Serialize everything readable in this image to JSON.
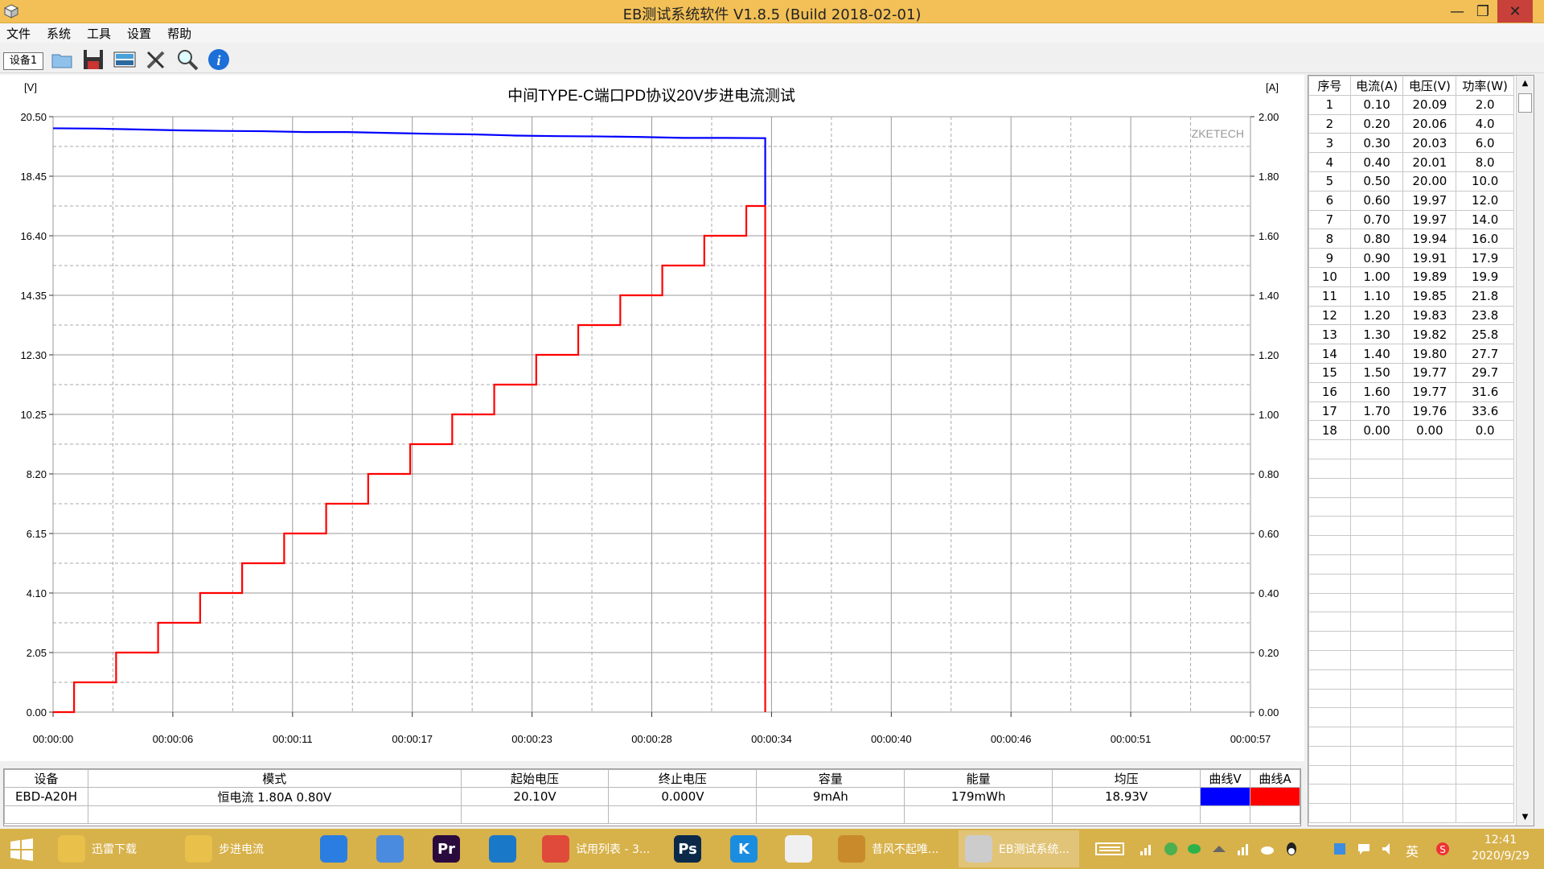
{
  "window": {
    "title": "EB测试系统软件 V1.8.5 (Build 2018-02-01)",
    "min": "—",
    "max": "❐",
    "close": "✕"
  },
  "menu": [
    "文件",
    "系统",
    "工具",
    "设置",
    "帮助"
  ],
  "toolbar": {
    "device_tab": "设备1"
  },
  "chart_data": {
    "type": "line",
    "title": "中间TYPE-C端口PD协议20V步进电流测试",
    "ylabel_left": "[V]",
    "ylabel_right": "[A]",
    "watermark": "ZKETECH",
    "x_ticks": [
      "00:00:00",
      "00:00:06",
      "00:00:11",
      "00:00:17",
      "00:00:23",
      "00:00:28",
      "00:00:34",
      "00:00:40",
      "00:00:46",
      "00:00:51",
      "00:00:57"
    ],
    "y_left_ticks": [
      "20.50",
      "18.45",
      "16.40",
      "14.35",
      "12.30",
      "10.25",
      "8.20",
      "6.15",
      "4.10",
      "2.05",
      "0.00"
    ],
    "y_right_ticks": [
      "2.00",
      "1.80",
      "1.60",
      "1.40",
      "1.20",
      "1.00",
      "0.80",
      "0.60",
      "0.40",
      "0.20",
      "0.00"
    ],
    "ylim_left": [
      0,
      20.5
    ],
    "ylim_right": [
      0,
      2.0
    ],
    "xlim_seconds": [
      0,
      57
    ],
    "grid": true,
    "series": [
      {
        "name": "曲线V",
        "color": "#0000ff",
        "axis": "left",
        "t": [
          0,
          2,
          4,
          6,
          8,
          10,
          12,
          14,
          16,
          18,
          20,
          22,
          24,
          26,
          28,
          30,
          32,
          33.9,
          33.9
        ],
        "values": [
          20.1,
          20.09,
          20.06,
          20.03,
          20.01,
          20.0,
          19.97,
          19.97,
          19.94,
          19.91,
          19.89,
          19.85,
          19.83,
          19.82,
          19.8,
          19.77,
          19.77,
          19.76,
          17.45
        ]
      },
      {
        "name": "曲线A",
        "color": "#ff0000",
        "axis": "right",
        "t": [
          0,
          1,
          3,
          5,
          7,
          9,
          11,
          13,
          15,
          17,
          19,
          21,
          23,
          25,
          27,
          29,
          31,
          33,
          33.9,
          33.9
        ],
        "values": [
          0.0,
          0.1,
          0.2,
          0.3,
          0.4,
          0.5,
          0.6,
          0.7,
          0.8,
          0.9,
          1.0,
          1.1,
          1.2,
          1.3,
          1.4,
          1.5,
          1.6,
          1.7,
          1.7,
          0.0
        ]
      }
    ]
  },
  "summary": {
    "headers": [
      "设备",
      "模式",
      "起始电压",
      "终止电压",
      "容量",
      "能量",
      "均压",
      "曲线V",
      "曲线A"
    ],
    "row": {
      "device": "EBD-A20H",
      "mode": "恒电流 1.80A 0.80V",
      "start_v": "20.10V",
      "end_v": "0.000V",
      "capacity": "9mAh",
      "energy": "179mWh",
      "avg_v": "18.93V"
    },
    "curve_v_color": "#0000ff",
    "curve_a_color": "#ff0000"
  },
  "data_table": {
    "headers": [
      "序号",
      "电流(A)",
      "电压(V)",
      "功率(W)"
    ],
    "rows": [
      [
        "1",
        "0.10",
        "20.09",
        "2.0"
      ],
      [
        "2",
        "0.20",
        "20.06",
        "4.0"
      ],
      [
        "3",
        "0.30",
        "20.03",
        "6.0"
      ],
      [
        "4",
        "0.40",
        "20.01",
        "8.0"
      ],
      [
        "5",
        "0.50",
        "20.00",
        "10.0"
      ],
      [
        "6",
        "0.60",
        "19.97",
        "12.0"
      ],
      [
        "7",
        "0.70",
        "19.97",
        "14.0"
      ],
      [
        "8",
        "0.80",
        "19.94",
        "16.0"
      ],
      [
        "9",
        "0.90",
        "19.91",
        "17.9"
      ],
      [
        "10",
        "1.00",
        "19.89",
        "19.9"
      ],
      [
        "11",
        "1.10",
        "19.85",
        "21.8"
      ],
      [
        "12",
        "1.20",
        "19.83",
        "23.8"
      ],
      [
        "13",
        "1.30",
        "19.82",
        "25.8"
      ],
      [
        "14",
        "1.40",
        "19.80",
        "27.7"
      ],
      [
        "15",
        "1.50",
        "19.77",
        "29.7"
      ],
      [
        "16",
        "1.60",
        "19.77",
        "31.6"
      ],
      [
        "17",
        "1.70",
        "19.76",
        "33.6"
      ],
      [
        "18",
        "0.00",
        "0.00",
        "0.0"
      ]
    ],
    "empty_rows": 20
  },
  "taskbar": {
    "apps": [
      {
        "label": "迅雷下载",
        "icon": "folder-icon",
        "color": "#e8c04a"
      },
      {
        "label": "步进电流",
        "icon": "folder-icon",
        "color": "#e8c04a"
      },
      {
        "label": "",
        "icon": "sogou-icon",
        "color": "#2a7de1"
      },
      {
        "label": "",
        "icon": "bird-icon",
        "color": "#4a8be0"
      },
      {
        "label": "",
        "icon": "premiere-icon",
        "color": "#2b0a3d",
        "glyph": "Pr"
      },
      {
        "label": "",
        "icon": "browser-icon",
        "color": "#1a78c9"
      },
      {
        "label": "试用列表 - 3...",
        "icon": "chrome-icon",
        "color": "#e04a3a"
      },
      {
        "label": "",
        "icon": "photoshop-icon",
        "color": "#0b2a4a",
        "glyph": "Ps"
      },
      {
        "label": "",
        "icon": "kugou-icon",
        "color": "#1a8de0",
        "glyph": "K"
      },
      {
        "label": "",
        "icon": "youku-icon",
        "color": "#f0f0f0"
      },
      {
        "label": "昔风不起唯...",
        "icon": "avatar-icon",
        "color": "#c88a2a"
      },
      {
        "label": "EB测试系统...",
        "icon": "eb-app-icon",
        "color": "#cccccc"
      }
    ],
    "ime": "英",
    "clock_time": "12:41",
    "clock_date": "2020/9/29"
  }
}
